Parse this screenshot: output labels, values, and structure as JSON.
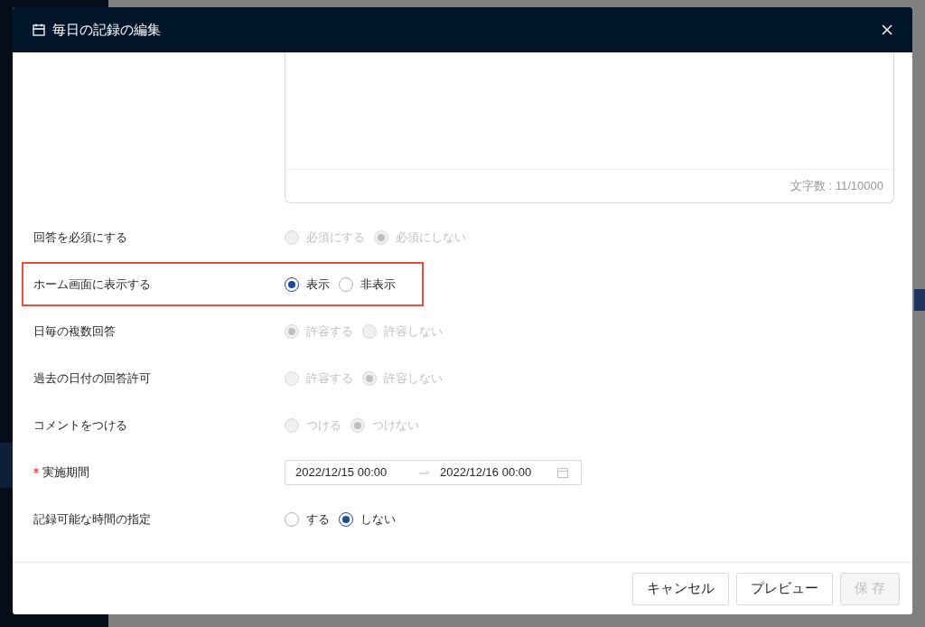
{
  "dialog": {
    "title": "毎日の記録の編集",
    "char_count": "文字数 : 11/10000",
    "fields": [
      {
        "kind": "radio",
        "label": "回答を必須にする",
        "required": false,
        "disabled": true,
        "highlighted": false,
        "options": [
          {
            "label": "必須にする",
            "selected": false
          },
          {
            "label": "必須にしない",
            "selected": true
          }
        ]
      },
      {
        "kind": "radio",
        "label": "ホーム画面に表示する",
        "required": false,
        "disabled": false,
        "highlighted": true,
        "options": [
          {
            "label": "表示",
            "selected": true
          },
          {
            "label": "非表示",
            "selected": false
          }
        ]
      },
      {
        "kind": "radio",
        "label": "日毎の複数回答",
        "required": false,
        "disabled": true,
        "highlighted": false,
        "options": [
          {
            "label": "許容する",
            "selected": true
          },
          {
            "label": "許容しない",
            "selected": false
          }
        ]
      },
      {
        "kind": "radio",
        "label": "過去の日付の回答許可",
        "required": false,
        "disabled": true,
        "highlighted": false,
        "options": [
          {
            "label": "許容する",
            "selected": false
          },
          {
            "label": "許容しない",
            "selected": true
          }
        ]
      },
      {
        "kind": "radio",
        "label": "コメントをつける",
        "required": false,
        "disabled": true,
        "highlighted": false,
        "options": [
          {
            "label": "つける",
            "selected": false
          },
          {
            "label": "つけない",
            "selected": true
          }
        ]
      },
      {
        "kind": "daterange",
        "label": "実施期間",
        "required": true,
        "highlighted": false,
        "start": "2022/12/15 00:00",
        "end": "2022/12/16 00:00"
      },
      {
        "kind": "radio",
        "label": "記録可能な時間の指定",
        "required": false,
        "disabled": false,
        "highlighted": false,
        "options": [
          {
            "label": "する",
            "selected": false
          },
          {
            "label": "しない",
            "selected": true
          }
        ]
      }
    ],
    "buttons": [
      {
        "label": "キャンセル",
        "disabled": false
      },
      {
        "label": "プレビュー",
        "disabled": false
      },
      {
        "label": "保 存",
        "disabled": true
      }
    ]
  }
}
